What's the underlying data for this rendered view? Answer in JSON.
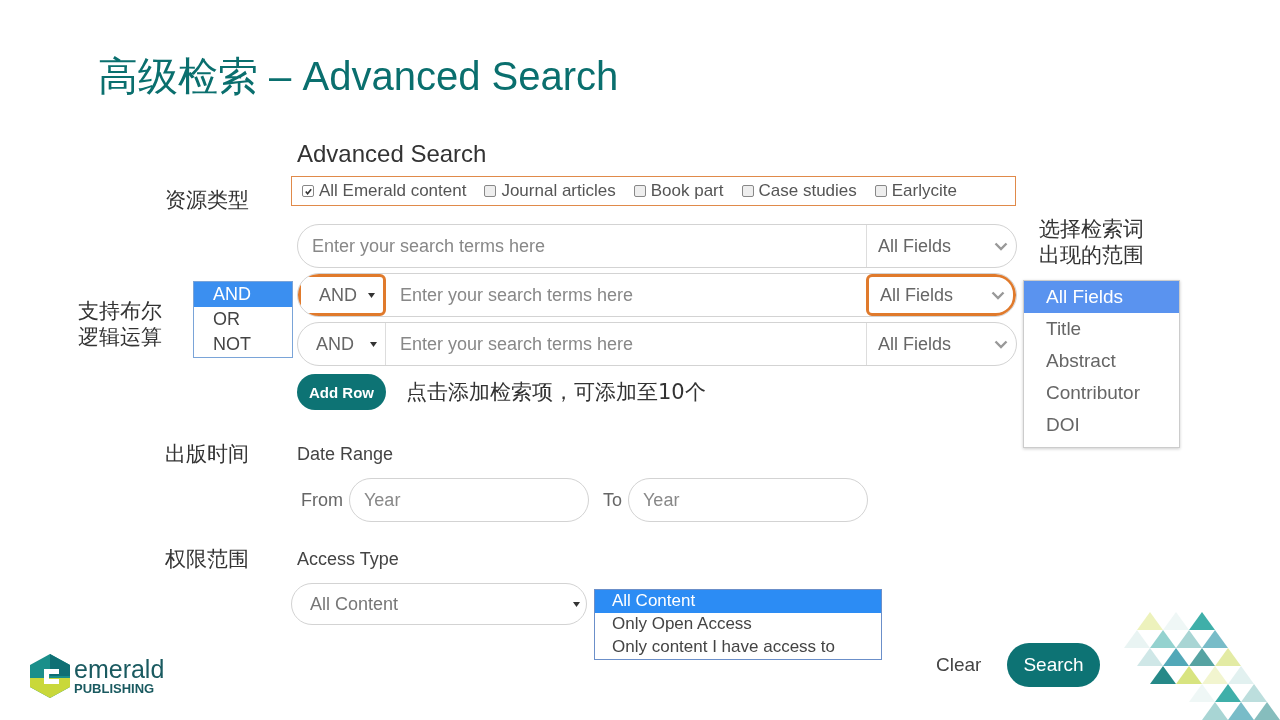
{
  "slide_title": "高级检索 – Advanced Search",
  "heading": "Advanced Search",
  "resource_type": {
    "annotation": "资源类型",
    "options": [
      {
        "label": "All Emerald content",
        "checked": true
      },
      {
        "label": "Journal articles",
        "checked": false
      },
      {
        "label": "Book part",
        "checked": false
      },
      {
        "label": "Case studies",
        "checked": false
      },
      {
        "label": "Earlycite",
        "checked": false
      }
    ]
  },
  "search_rows": [
    {
      "kind": "plain",
      "placeholder": "Enter your search terms here",
      "field": "All Fields",
      "highlighted": false
    },
    {
      "kind": "operator",
      "operator": "AND",
      "placeholder": "Enter your search terms here",
      "field": "All Fields",
      "highlighted": true
    },
    {
      "kind": "operator",
      "operator": "AND",
      "placeholder": "Enter your search terms here",
      "field": "All Fields",
      "highlighted": false
    }
  ],
  "operator_menu": {
    "annotation": "支持布尔逻辑运算",
    "items": [
      {
        "label": "AND",
        "selected": true
      },
      {
        "label": "OR",
        "selected": false
      },
      {
        "label": "NOT",
        "selected": false
      }
    ]
  },
  "field_menu": {
    "annotation": "选择检索词出现的范围",
    "items": [
      {
        "label": "All Fields",
        "selected": true
      },
      {
        "label": "Title",
        "selected": false
      },
      {
        "label": "Abstract",
        "selected": false
      },
      {
        "label": "Contributor",
        "selected": false
      },
      {
        "label": "DOI",
        "selected": false
      }
    ]
  },
  "add_row": {
    "label": "Add Row",
    "annotation": "点击添加检索项，可添加至10个"
  },
  "date": {
    "annotation": "出版时间",
    "label": "Date Range",
    "from_label": "From",
    "from_placeholder": "Year",
    "to_label": "To",
    "to_placeholder": "Year"
  },
  "access": {
    "annotation": "权限范围",
    "label": "Access Type",
    "value": "All Content",
    "options": [
      {
        "label": "All Content",
        "selected": true
      },
      {
        "label": "Only Open Access",
        "selected": false
      },
      {
        "label": "Only content I have access to",
        "selected": false
      }
    ]
  },
  "buttons": {
    "clear": "Clear",
    "search": "Search"
  },
  "logo": {
    "name": "emerald",
    "tagline": "PUBLISHING"
  }
}
